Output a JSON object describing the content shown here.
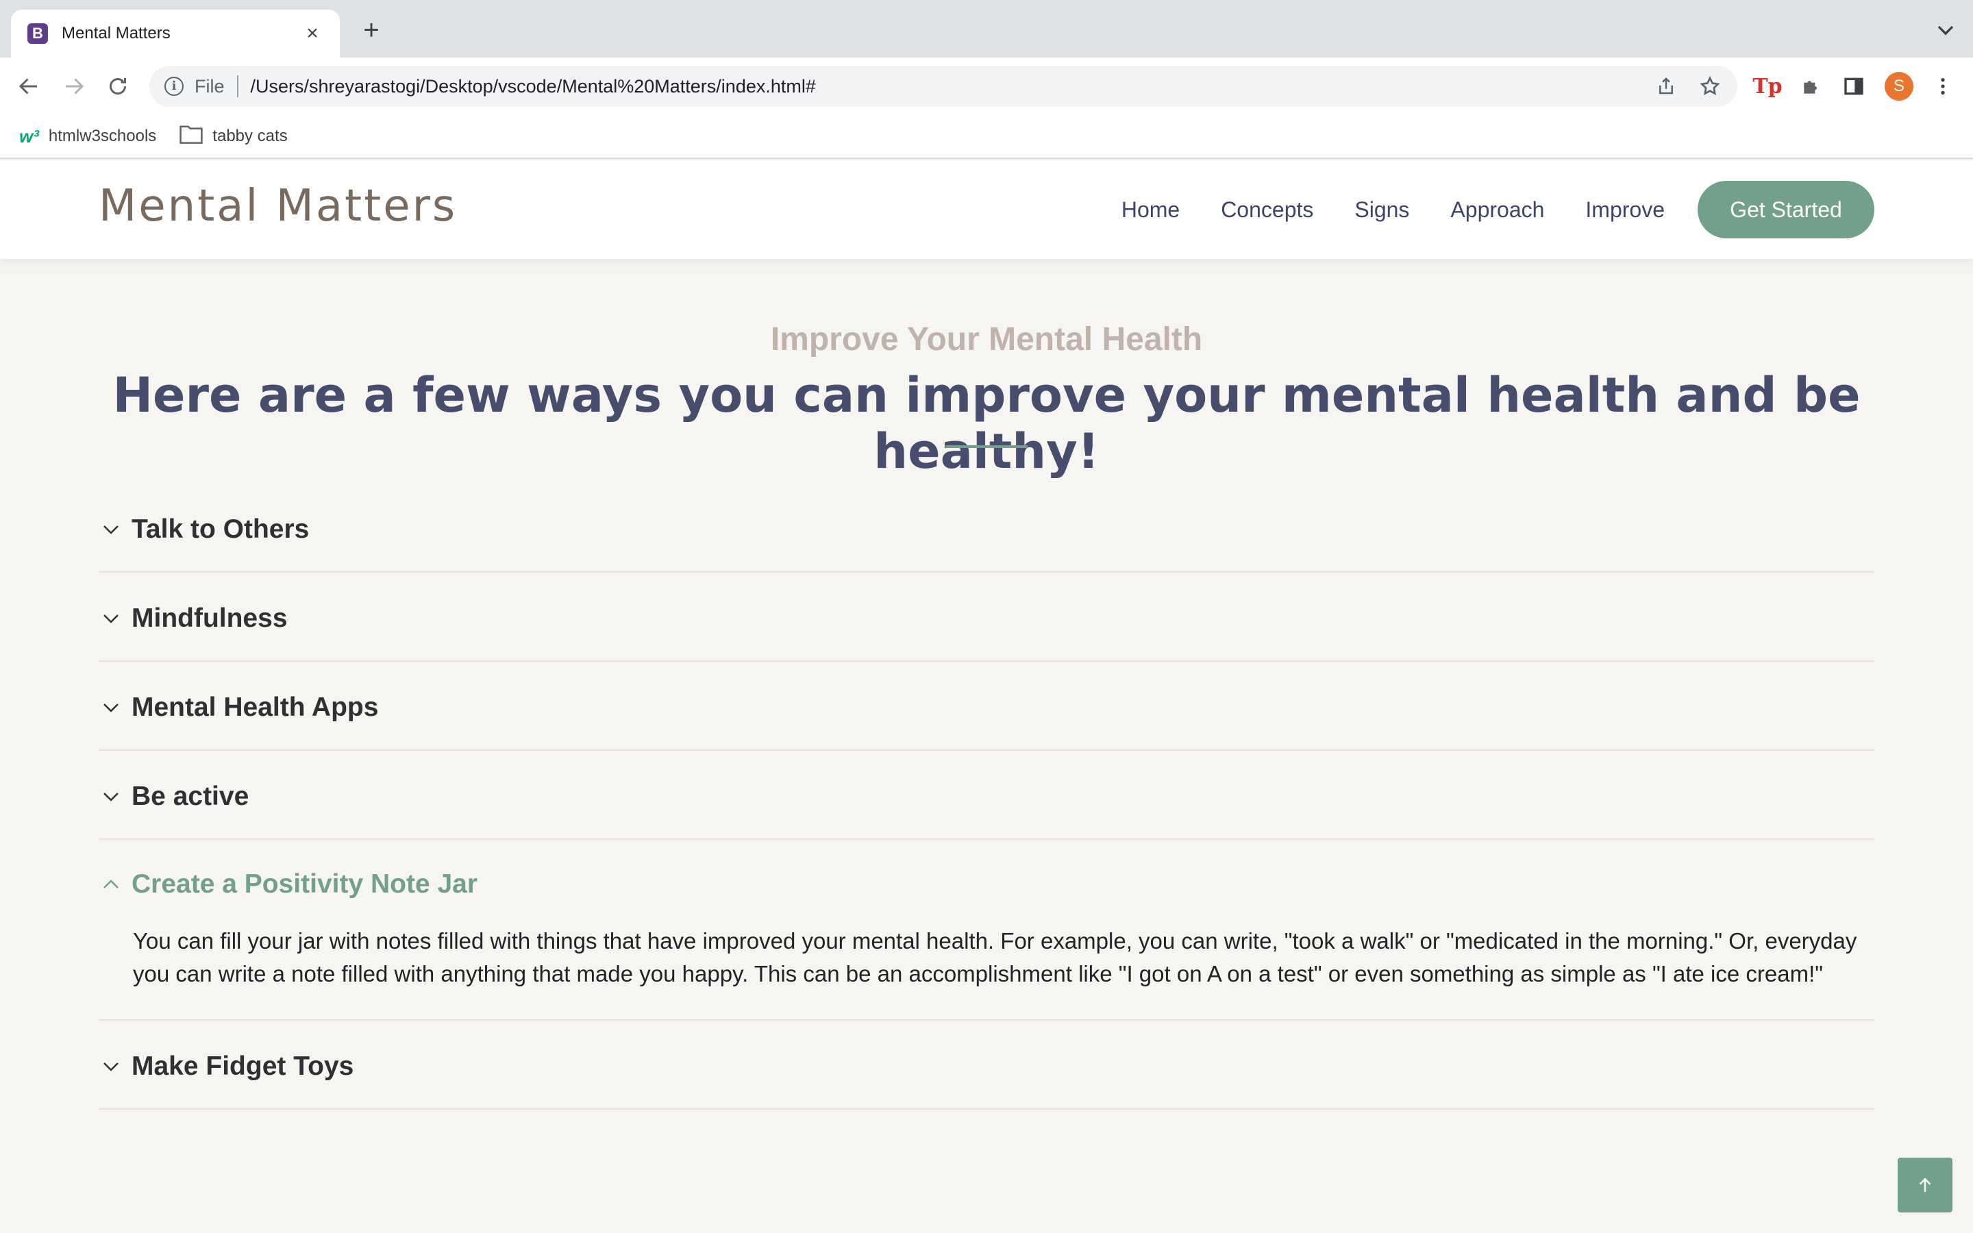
{
  "browser": {
    "tab_title": "Mental Matters",
    "favicon_letter": "B",
    "omnibox_scheme": "File",
    "url": "/Users/shreyarastogi/Desktop/vscode/Mental%20Matters/index.html#",
    "profile_initial": "S",
    "extension_tp_label": "Tp",
    "bookmarks": [
      {
        "label": "htmlw3schools",
        "icon_text": "w³"
      },
      {
        "label": "tabby cats"
      }
    ]
  },
  "site": {
    "brand": "Mental Matters",
    "nav": [
      "Home",
      "Concepts",
      "Signs",
      "Approach",
      "Improve"
    ],
    "cta_label": "Get Started",
    "accent_color": "#72a08b"
  },
  "section": {
    "subtitle": "Improve Your Mental Health",
    "title": "Here are a few ways you can improve your mental health and be healthy!",
    "items": [
      {
        "title": "Talk to Others",
        "open": false
      },
      {
        "title": "Mindfulness",
        "open": false
      },
      {
        "title": "Mental Health Apps",
        "open": false
      },
      {
        "title": "Be active",
        "open": false
      },
      {
        "title": "Create a Positivity Note Jar",
        "open": true,
        "body": "You can fill your jar with notes filled with things that have improved your mental health. For example, you can write, \"took a walk\" or \"medicated in the morning.\" Or, everyday you can write a note filled with anything that made you happy. This can be an accomplishment like \"I got on A on a test\" or even something as simple as \"I ate ice cream!\""
      },
      {
        "title": "Make Fidget Toys",
        "open": false
      }
    ]
  }
}
